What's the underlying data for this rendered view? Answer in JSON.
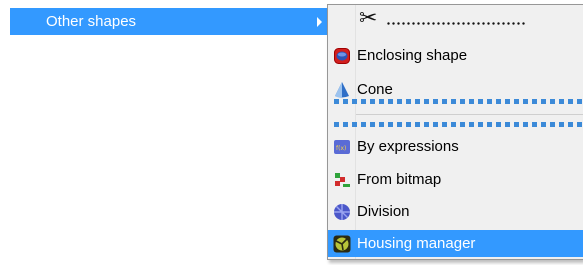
{
  "parent_menu": {
    "label": "Other shapes"
  },
  "submenu": {
    "tearoff_icon": "scissors-icon",
    "items": [
      {
        "label": "Enclosing shape",
        "icon": "enclosing-shape-icon"
      },
      {
        "label": "Cone",
        "icon": "cone-icon"
      },
      {
        "label": "By expressions",
        "icon": "expressions-icon"
      },
      {
        "label": "From bitmap",
        "icon": "bitmap-icon"
      },
      {
        "label": "Division",
        "icon": "division-icon"
      },
      {
        "label": "Housing manager",
        "icon": "housing-manager-icon",
        "selected": true
      }
    ]
  },
  "colors": {
    "highlight": "#3399ff",
    "menu_background": "#f0f0f0",
    "torn_edge": "#3c8ad8"
  }
}
